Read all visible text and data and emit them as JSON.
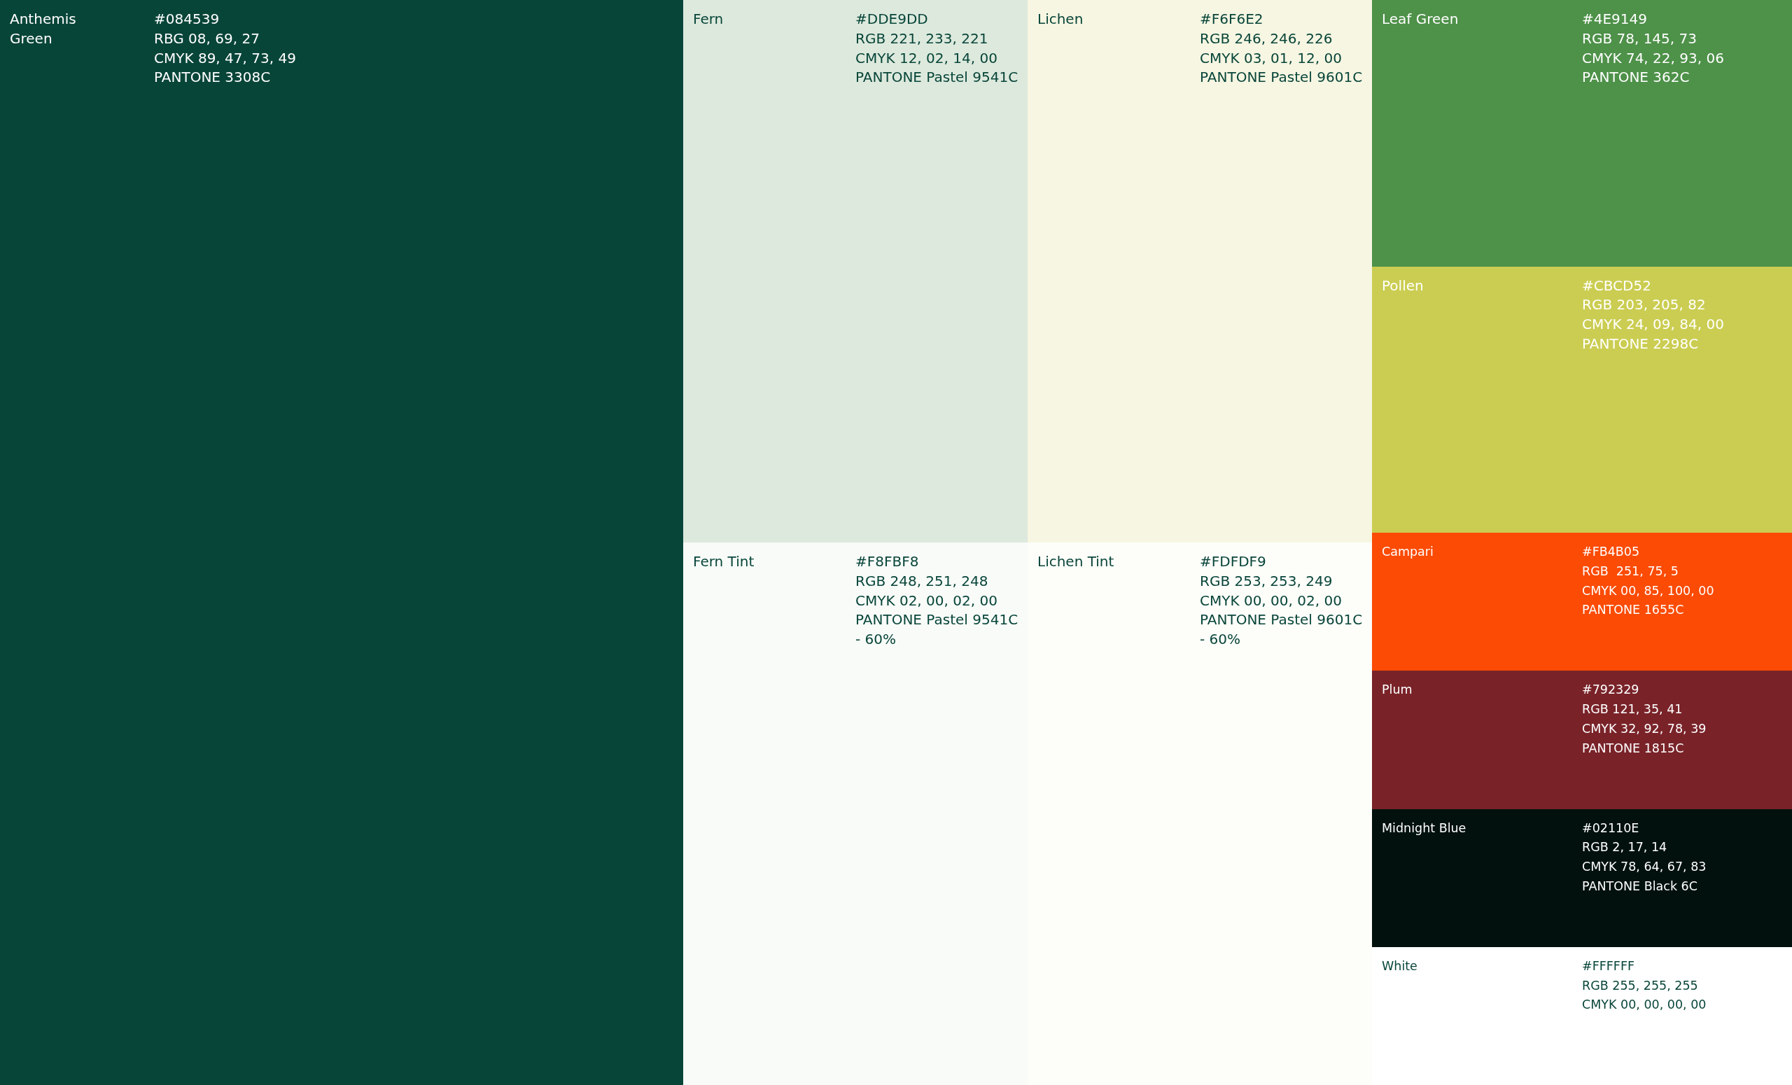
{
  "columns": [
    {
      "swatches": [
        {
          "kind": "full",
          "name": "Anthemis Green",
          "color": "#084539",
          "details": [
            "#084539",
            "RBG 08, 69, 27",
            "CMYK 89, 47, 73, 49",
            "PANTONE 3308C"
          ]
        }
      ]
    },
    {
      "swatches": [
        {
          "kind": "large",
          "name": "Fern",
          "color": "#dde9dd",
          "details": [
            "#DDE9DD",
            "RGB 221, 233, 221",
            "CMYK 12, 02, 14, 00",
            "PANTONE Pastel 9541C"
          ]
        },
        {
          "kind": "large",
          "name": "Fern Tint",
          "color": "#f8fbf8",
          "details": [
            "#F8FBF8",
            "RGB 248, 251, 248",
            "CMYK 02, 00, 02, 00",
            "PANTONE Pastel 9541C - 60%"
          ]
        }
      ]
    },
    {
      "swatches": [
        {
          "kind": "large",
          "name": "Lichen",
          "color": "#f6f6e2",
          "details": [
            "#F6F6E2",
            "RGB 246, 246, 226",
            "CMYK 03, 01, 12, 00",
            "PANTONE Pastel 9601C"
          ]
        },
        {
          "kind": "large",
          "name": "Lichen Tint",
          "color": "#fdfdf9",
          "details": [
            "#FDFDF9",
            "RGB 253, 253, 249",
            "CMYK 00, 00, 02, 00",
            "PANTONE Pastel 9601C - 60%"
          ]
        }
      ]
    },
    {
      "swatches": [
        {
          "kind": "large",
          "name": "Leaf Green",
          "color": "#4e9149",
          "details": [
            "#4E9149",
            "RGB 78, 145, 73",
            "CMYK 74, 22, 93, 06",
            "PANTONE 362C"
          ]
        },
        {
          "kind": "large",
          "name": "Pollen",
          "color": "#cbcd52",
          "details": [
            "#CBCD52",
            "RGB 203, 205, 82",
            "CMYK 24, 09, 84, 00",
            "PANTONE 2298C"
          ]
        },
        {
          "kind": "small",
          "name": "Campari",
          "color": "#fb4b05",
          "details": [
            "#FB4B05",
            "RGB  251, 75, 5",
            "CMYK 00, 85, 100, 00",
            "PANTONE 1655C"
          ]
        },
        {
          "kind": "small",
          "name": "Plum",
          "color": "#792329",
          "details": [
            "#792329",
            "RGB 121, 35, 41",
            "CMYK 32, 92, 78, 39",
            "PANTONE 1815C"
          ]
        },
        {
          "kind": "small",
          "name": "Midnight Blue",
          "color": "#02110e",
          "details": [
            "#02110E",
            "RGB 2, 17, 14",
            "CMYK 78, 64, 67, 83",
            "PANTONE Black 6C"
          ]
        },
        {
          "kind": "small",
          "name": "White",
          "color": "#ffffff",
          "details": [
            "#FFFFFF",
            "RGB 255, 255, 255",
            "CMYK 00, 00, 00, 00"
          ]
        }
      ]
    }
  ]
}
